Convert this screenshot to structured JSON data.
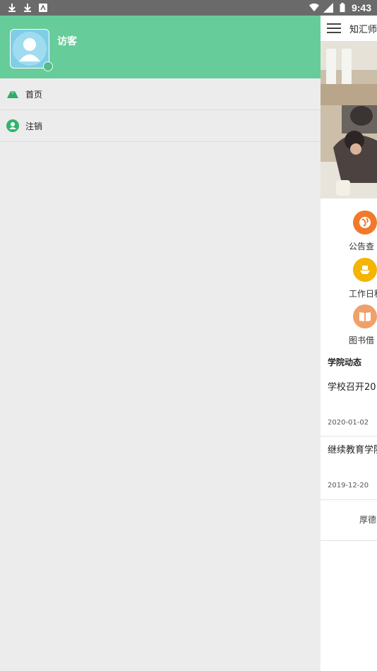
{
  "status_bar": {
    "time": "9:43"
  },
  "drawer": {
    "username": "访客",
    "menu": [
      {
        "label": "首页",
        "icon": "home-icon"
      },
      {
        "label": "注销",
        "icon": "user-logout-icon"
      }
    ]
  },
  "main": {
    "title": "知汇师",
    "grid": [
      {
        "label": "公告查",
        "icon": "globe-icon",
        "color": "#f07a2a"
      },
      {
        "label": "工作日程",
        "icon": "ship-icon",
        "color": "#f4b400"
      },
      {
        "label": "图书借",
        "icon": "book-icon",
        "color": "#f0a06a"
      }
    ],
    "section_title": "学院动态",
    "news": [
      {
        "title": "学校召开20",
        "date": "2020-01-02"
      },
      {
        "title": "继续教育学院",
        "date": "2019-12-20"
      }
    ],
    "footer_text": "厚德"
  },
  "colors": {
    "drawer_header": "#66cc99",
    "drawer_bg": "#ececec",
    "status_bar": "#6a6a6a"
  }
}
